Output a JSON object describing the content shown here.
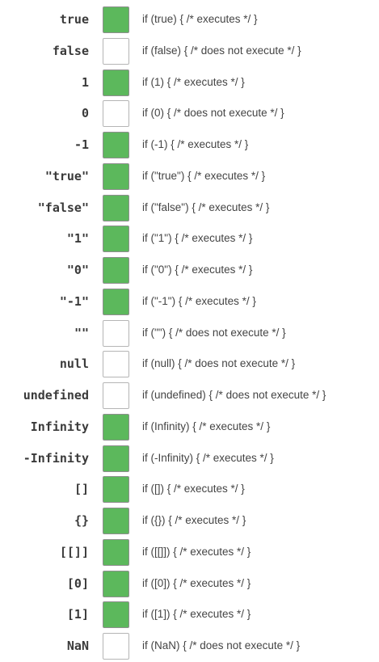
{
  "colors": {
    "truthy": "#5cb85c",
    "falsy": "#ffffff"
  },
  "rows": [
    {
      "value": "true",
      "truthy": true,
      "code": "if (true) { /* executes */ }"
    },
    {
      "value": "false",
      "truthy": false,
      "code": "if (false) { /* does not execute */ }"
    },
    {
      "value": "1",
      "truthy": true,
      "code": "if (1) { /* executes */ }"
    },
    {
      "value": "0",
      "truthy": false,
      "code": "if (0) { /* does not execute */ }"
    },
    {
      "value": "-1",
      "truthy": true,
      "code": "if (-1) { /* executes */ }"
    },
    {
      "value": "\"true\"",
      "truthy": true,
      "code": "if (\"true\") { /* executes */ }"
    },
    {
      "value": "\"false\"",
      "truthy": true,
      "code": "if (\"false\") { /* executes */ }"
    },
    {
      "value": "\"1\"",
      "truthy": true,
      "code": "if (\"1\") { /* executes */ }"
    },
    {
      "value": "\"0\"",
      "truthy": true,
      "code": "if (\"0\") { /* executes */ }"
    },
    {
      "value": "\"-1\"",
      "truthy": true,
      "code": "if (\"-1\") { /* executes */ }"
    },
    {
      "value": "\"\"",
      "truthy": false,
      "code": "if (\"\") { /* does not execute */ }"
    },
    {
      "value": "null",
      "truthy": false,
      "code": "if (null) { /* does not execute */ }"
    },
    {
      "value": "undefined",
      "truthy": false,
      "code": "if (undefined) { /* does not execute */ }"
    },
    {
      "value": "Infinity",
      "truthy": true,
      "code": "if (Infinity) { /* executes */ }"
    },
    {
      "value": "-Infinity",
      "truthy": true,
      "code": "if (-Infinity) { /* executes */ }"
    },
    {
      "value": "[]",
      "truthy": true,
      "code": "if ([]) { /* executes */ }"
    },
    {
      "value": "{}",
      "truthy": true,
      "code": "if ({}) { /* executes */ }"
    },
    {
      "value": "[[]]",
      "truthy": true,
      "code": "if ([[]]) { /* executes */ }"
    },
    {
      "value": "[0]",
      "truthy": true,
      "code": "if ([0]) { /* executes */ }"
    },
    {
      "value": "[1]",
      "truthy": true,
      "code": "if ([1]) { /* executes */ }"
    },
    {
      "value": "NaN",
      "truthy": false,
      "code": "if (NaN) { /* does not execute */ }"
    }
  ]
}
